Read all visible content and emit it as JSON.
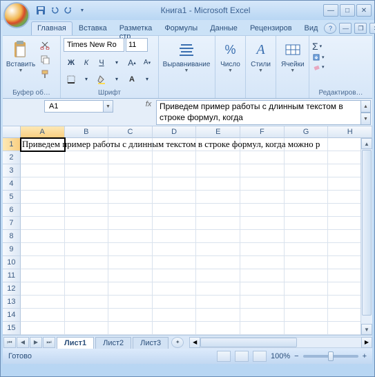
{
  "title": "Книга1 - Microsoft Excel",
  "tabs": [
    "Главная",
    "Вставка",
    "Разметка стр",
    "Формулы",
    "Данные",
    "Рецензиров",
    "Вид"
  ],
  "activeTab": 0,
  "clipboard": {
    "label": "Буфер об…",
    "paste": "Вставить"
  },
  "font": {
    "label": "Шрифт",
    "name": "Times New Ro",
    "size": "11"
  },
  "alignment": {
    "label": "Выравнивание"
  },
  "number": {
    "label": "Число"
  },
  "styles": {
    "label": "Стили"
  },
  "cells": {
    "label": "Ячейки"
  },
  "editing": {
    "label": "Редактиров…"
  },
  "nameBox": "A1",
  "formulaBar": "Приведем пример работы с длинным текстом в строке формул, когда",
  "columns": [
    "A",
    "B",
    "C",
    "D",
    "E",
    "F",
    "G",
    "H"
  ],
  "rows": [
    "1",
    "2",
    "3",
    "4",
    "5",
    "6",
    "7",
    "8",
    "9",
    "10",
    "11",
    "12",
    "13",
    "14",
    "15"
  ],
  "activeCell": {
    "row": 0,
    "col": 0
  },
  "cellText": "Приведем пример работы с длинным текстом в строке формул, когда можно р",
  "sheets": [
    "Лист1",
    "Лист2",
    "Лист3"
  ],
  "activeSheet": 0,
  "status": "Готово",
  "zoom": "100%"
}
